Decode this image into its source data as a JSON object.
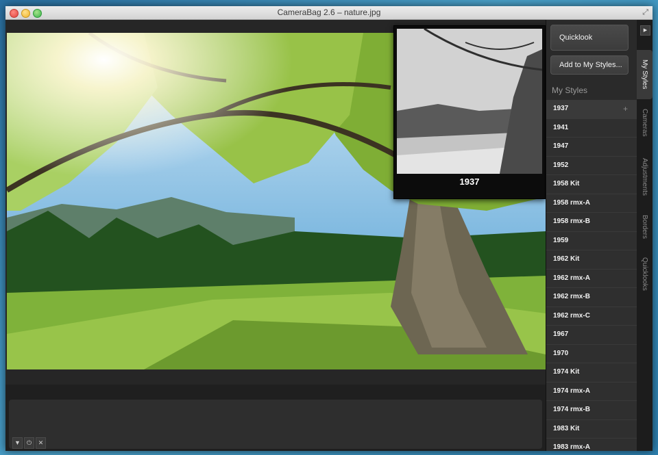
{
  "window": {
    "title": "CameraBag 2.6 – nature.jpg"
  },
  "quicklook_preview": {
    "label": "1937"
  },
  "sidebar": {
    "quicklook_button": "Quicklook",
    "add_button": "Add to My Styles...",
    "heading": "My Styles",
    "plus": "+",
    "styles": [
      "1937",
      "1941",
      "1947",
      "1952",
      "1958 Kit",
      "1958 rmx-A",
      "1958 rmx-B",
      "1959",
      "1962 Kit",
      "1962 rmx-A",
      "1962 rmx-B",
      "1962 rmx-C",
      "1967",
      "1970",
      "1974 Kit",
      "1974 rmx-A",
      "1974 rmx-B",
      "1983 Kit",
      "1983 rmx-A"
    ]
  },
  "tabs": [
    "My Styles",
    "Cameras",
    "Adjustments",
    "Borders",
    "Quicklooks"
  ],
  "bottom_controls": [
    "▼",
    "⏻",
    "✕"
  ],
  "colors": {
    "accent_bg": "#2a2a2a",
    "window_bg": "#1f1f1f"
  }
}
